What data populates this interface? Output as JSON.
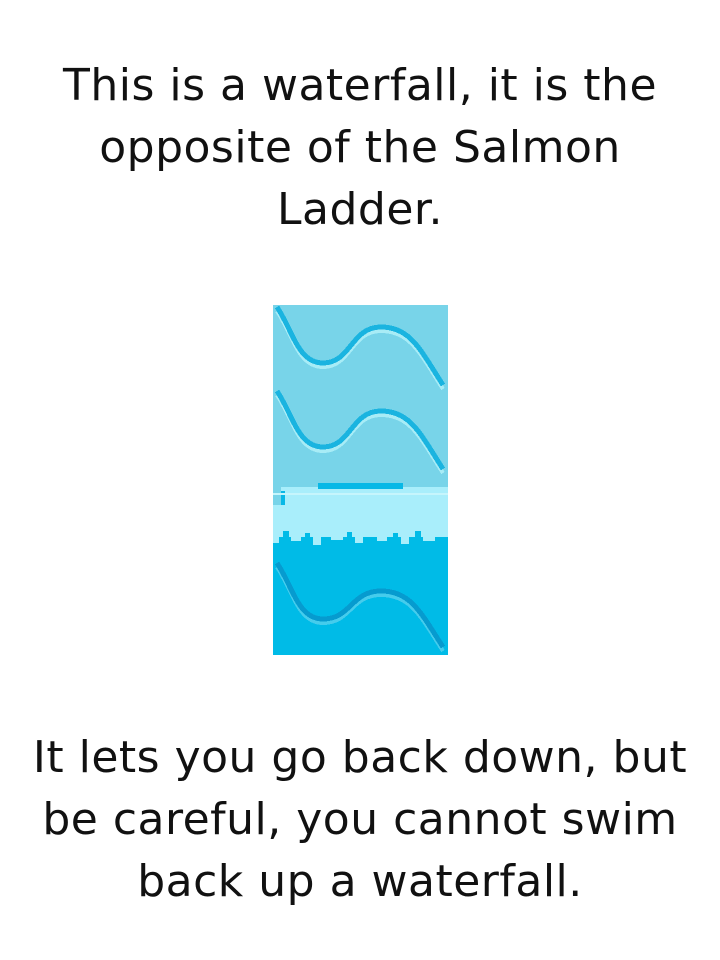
{
  "intro": {
    "lines": [
      "This is a waterfall, it is the",
      "opposite of the Salmon",
      "Ladder."
    ]
  },
  "tile": {
    "icon": "waterfall-tile-icon",
    "colors": {
      "upper_water": "#78d4e9",
      "upper_wave_dark": "#1ab4e0",
      "wave_light": "#a8ecf6",
      "foam": "#a9eefb",
      "lower_water": "#00bbe7",
      "lower_wave_dark": "#069bcf",
      "ledge_line": "#08b8e6"
    }
  },
  "outro": {
    "lines": [
      "It lets you go back down, but",
      "be careful, you cannot swim",
      "back up a waterfall."
    ]
  }
}
